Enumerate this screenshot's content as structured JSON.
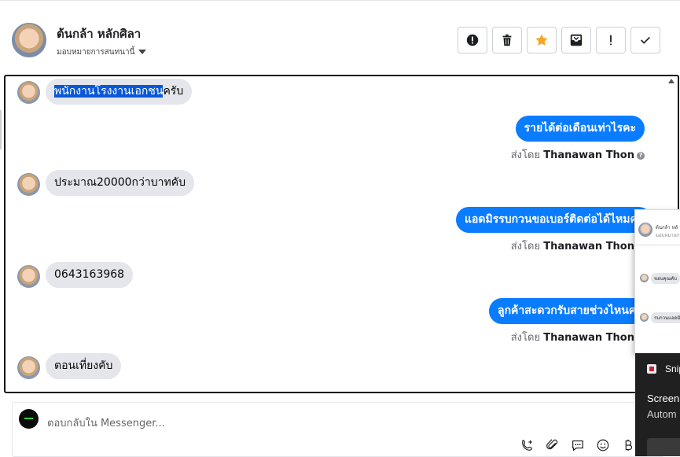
{
  "header": {
    "contact_name": "ต้นกล้า หลักศิลา",
    "assign_label": "มอบหมายการสนทนานี้"
  },
  "toolbar": {
    "buttons": [
      "mark-spam",
      "delete",
      "star",
      "archive",
      "mark-unread",
      "done"
    ]
  },
  "messages": [
    {
      "dir": "in",
      "text_highlight": "พนักงานโรงงานเอกชน",
      "text_rest": "ครับ"
    },
    {
      "dir": "out",
      "text": "รายได้ต่อเดือนเท่าไรคะ",
      "sent_by_prefix": "ส่งโดย",
      "sent_by_name": "Thanawan Thon"
    },
    {
      "dir": "in",
      "text": "ประมาณ20000กว่าบาทคับ"
    },
    {
      "dir": "out",
      "text": "แอดมิรรบกวนขอเบอร์ติดต่อได้ไหมคะ",
      "sent_by_prefix": "ส่งโดย",
      "sent_by_name": "Thanawan Thon"
    },
    {
      "dir": "in",
      "text": "0643163968"
    },
    {
      "dir": "out",
      "text": "ลูกค้าสะดวกรับสายช่วงไหนคะ",
      "sent_by_prefix": "ส่งโดย",
      "sent_by_name": "Thanawan Thon"
    },
    {
      "dir": "in",
      "text": "ตอนเที่ยงคับ"
    }
  ],
  "help_icon": "?",
  "reply": {
    "placeholder": "ตอบกลับใน Messenger..."
  },
  "popup": {
    "name": "ต้นกล้า หลั",
    "sub": "มอบหมายการ",
    "bubble1": "ขอบคุณคับ",
    "bubble2": "รบกวนแอดมิ"
  },
  "snip": {
    "title": "Snip",
    "heading": "Screen",
    "body": "Autom"
  },
  "colors": {
    "outgoing_bubble": "#0a7cff",
    "incoming_bubble": "#e4e6eb",
    "star": "#f5a623"
  }
}
